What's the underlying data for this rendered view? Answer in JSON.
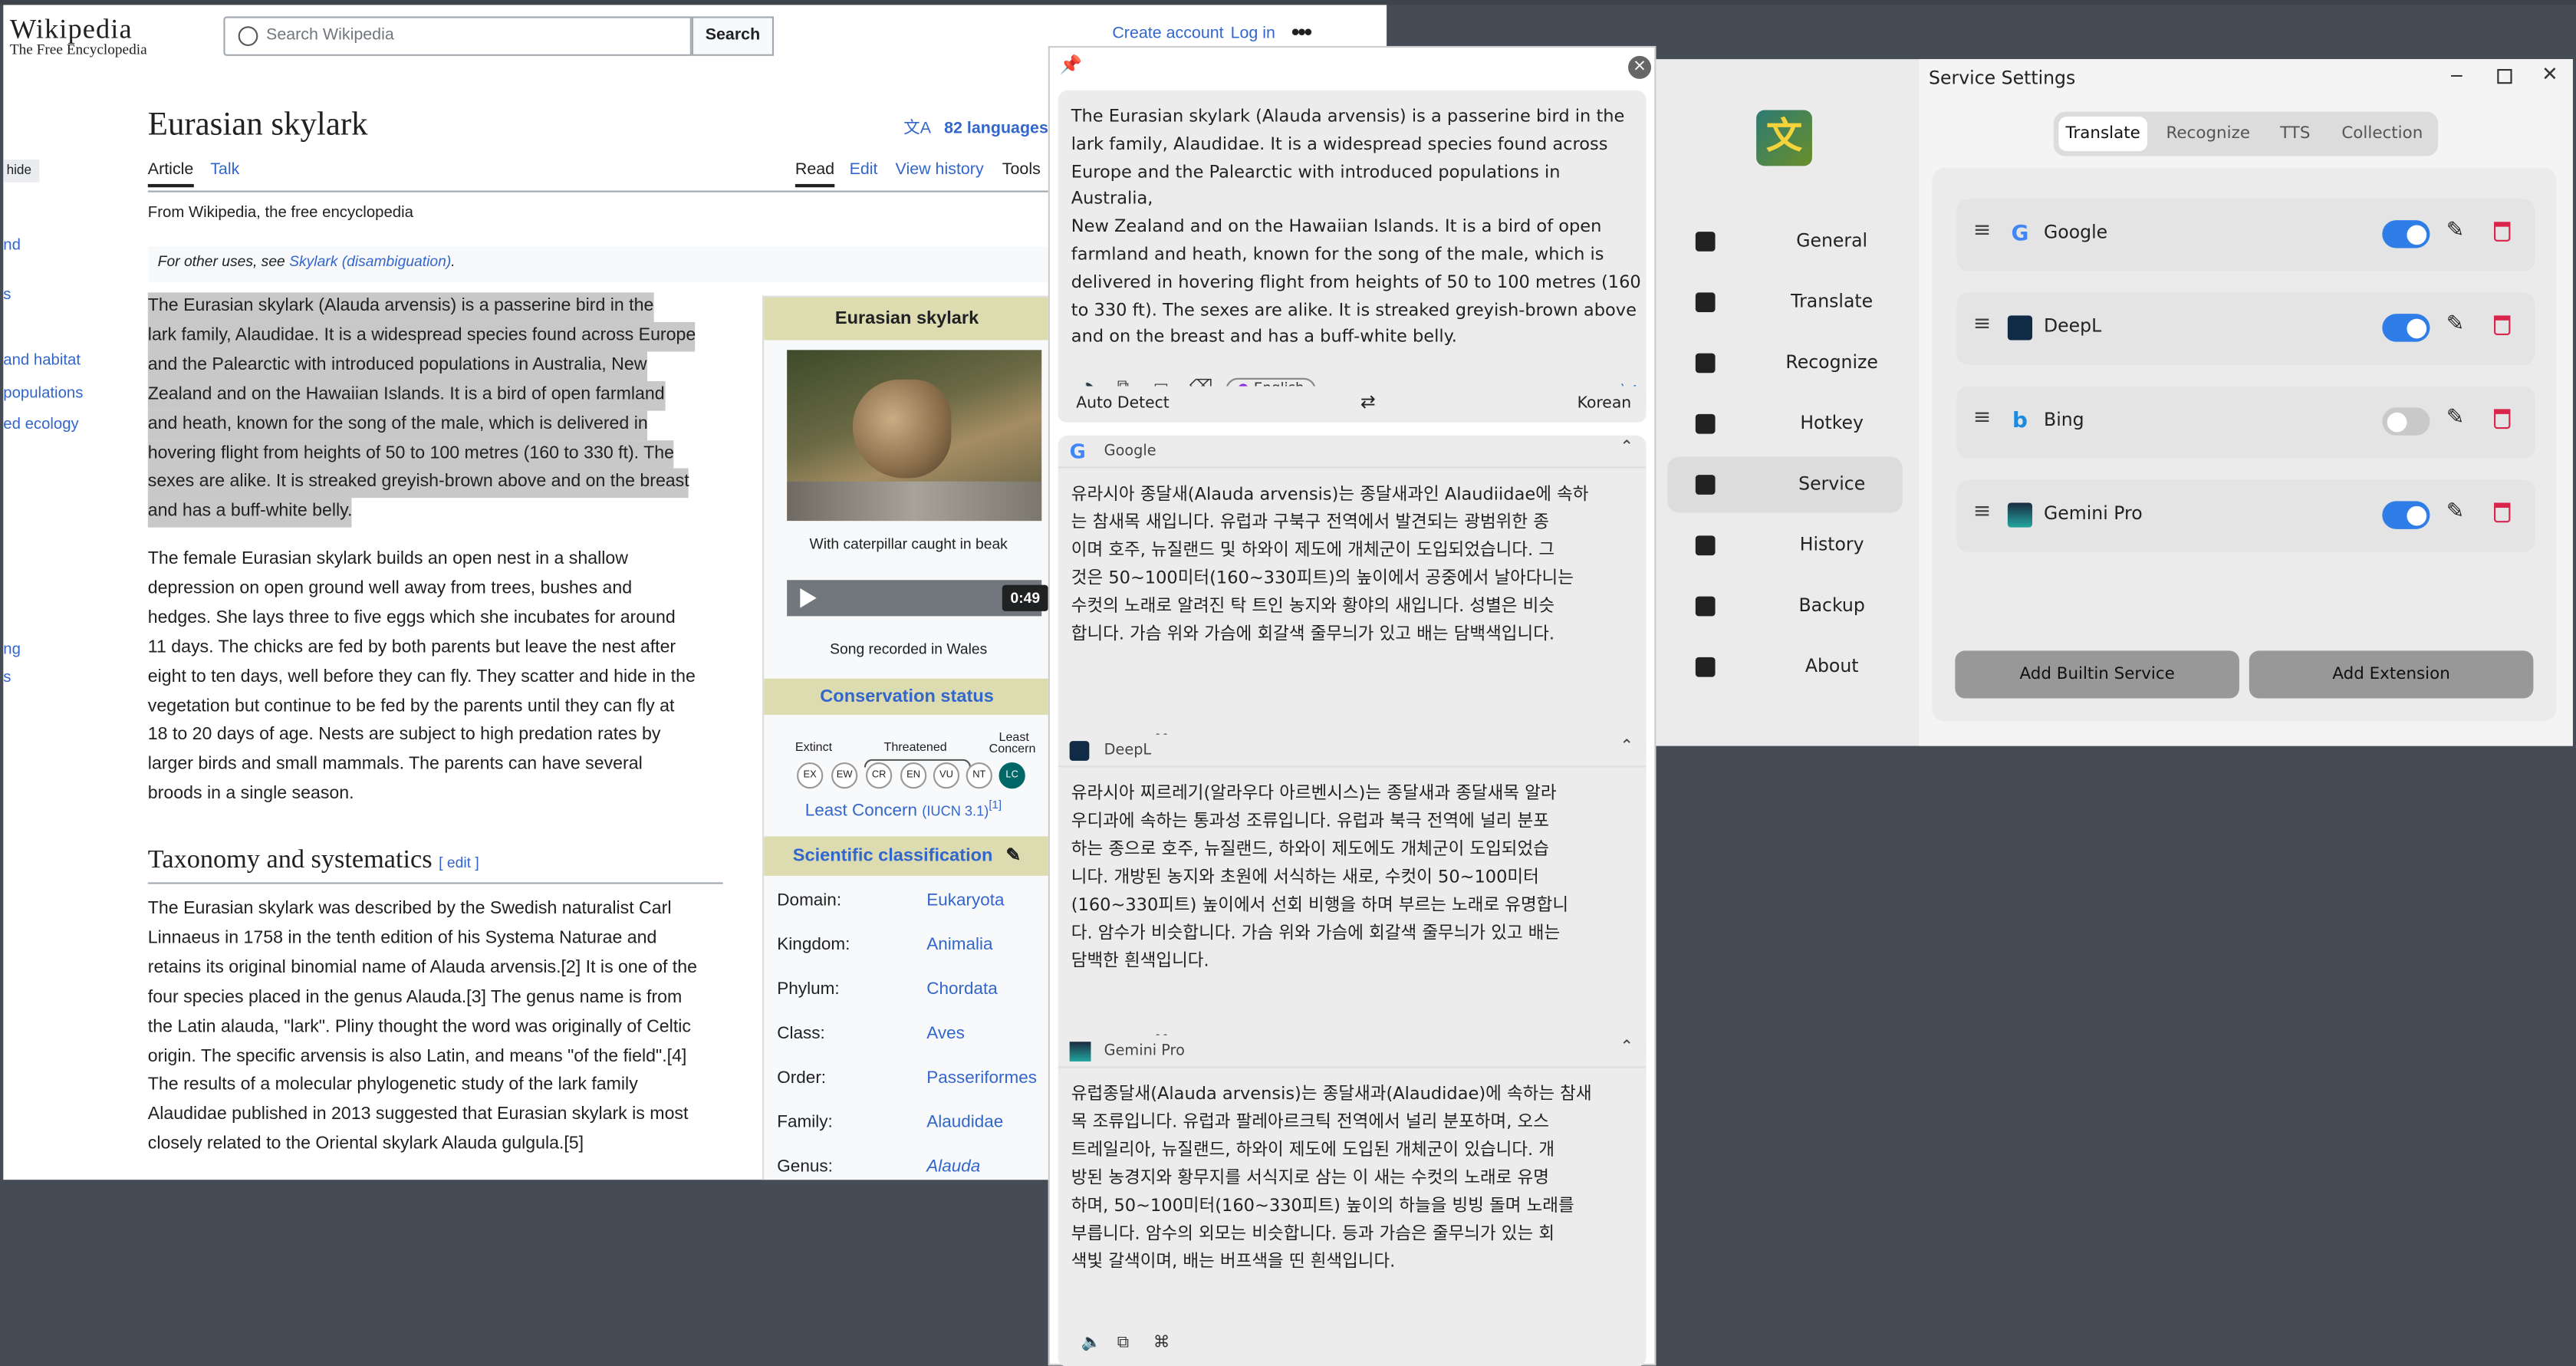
{
  "wiki": {
    "logo": "Wikipedia",
    "tagline": "The Free Encyclopedia",
    "search_placeholder": "Search Wikipedia",
    "search_button": "Search",
    "create_account": "Create account",
    "login": "Log in",
    "title": "Eurasian skylark",
    "languages": "82 languages",
    "tab_article": "Article",
    "tab_talk": "Talk",
    "tab_read": "Read",
    "tab_edit": "Edit",
    "tab_history": "View history",
    "tab_tools": "Tools",
    "from": "From Wikipedia, the free encyclopedia",
    "hatnote_prefix": "For other uses, see ",
    "hatnote_link": "Skylark (disambiguation)",
    "hatnote_suffix": ".",
    "hide": "hide",
    "leftnav": [
      "nd",
      "s",
      "and habitat",
      "populations",
      "ed ecology",
      "ng",
      "s"
    ],
    "para1": [
      "The Eurasian skylark (Alauda arvensis) is a passerine bird in the",
      "lark family, Alaudidae. It is a widespread species found across Europe",
      "and the Palearctic with introduced populations in Australia, New",
      "Zealand and on the Hawaiian Islands. It is a bird of open farmland",
      "and heath, known for the song of the male, which is delivered in",
      "hovering flight from heights of 50 to 100 metres (160 to 330 ft). The",
      "sexes are alike. It is streaked greyish-brown above and on the breast",
      "and has a buff-white belly."
    ],
    "para2": [
      "The female Eurasian skylark builds an open nest in a shallow",
      "depression on open ground well away from trees, bushes and",
      "hedges. She lays three to five eggs which she incubates for around",
      "11 days. The chicks are fed by both parents but leave the nest after",
      "eight to ten days, well before they can fly. They scatter and hide in the",
      "vegetation but continue to be fed by the parents until they can fly at",
      "18 to 20 days of age. Nests are subject to high predation rates by",
      "larger birds and small mammals. The parents can have several",
      "broods in a single season."
    ],
    "h2": "Taxonomy and systematics",
    "h2_edit": "[ edit ]",
    "para3": [
      "The Eurasian skylark was described by the Swedish naturalist Carl",
      "Linnaeus in 1758 in the tenth edition of his Systema Naturae and",
      "retains its original binomial name of Alauda arvensis.[2] It is one of the",
      "four species placed in the genus Alauda.[3] The genus name is from",
      "the Latin alauda, \"lark\". Pliny thought the word was originally of Celtic",
      "origin. The specific arvensis is also Latin, and means \"of the field\".[4]",
      "The results of a molecular phylogenetic study of the lark family",
      "Alaudidae published in 2013 suggested that Eurasian skylark is most",
      "closely related to the Oriental skylark Alauda gulgula.[5]"
    ],
    "infobox": {
      "title": "Eurasian skylark",
      "caption": "With caterpillar caught in beak",
      "duration": "0:49",
      "audio_caption": "Song recorded in Wales",
      "conservation": "Conservation status",
      "extinct": "Extinct",
      "threatened": "Threatened",
      "least_concern_top": "Least",
      "least_concern_bottom": "Concern",
      "codes": [
        "EX",
        "EW",
        "CR",
        "EN",
        "VU",
        "NT",
        "LC"
      ],
      "status_text": "Least Concern",
      "status_ref": "(IUCN 3.1)",
      "status_note": "[1]",
      "sci": "Scientific classification",
      "rows": [
        {
          "k": "Domain:",
          "v": "Eukaryota"
        },
        {
          "k": "Kingdom:",
          "v": "Animalia"
        },
        {
          "k": "Phylum:",
          "v": "Chordata"
        },
        {
          "k": "Class:",
          "v": "Aves"
        },
        {
          "k": "Order:",
          "v": "Passeriformes"
        },
        {
          "k": "Family:",
          "v": "Alaudidae"
        },
        {
          "k": "Genus:",
          "v": "Alauda"
        }
      ]
    }
  },
  "translator": {
    "source_text": [
      "The Eurasian skylark (Alauda arvensis) is a passerine bird in the",
      "lark family, Alaudidae. It is a widespread species found across",
      "Europe and the Palearctic with introduced populations in Australia,",
      "New Zealand and on the Hawaiian Islands. It is a bird of open",
      "farmland and heath, known for the song of the male, which is",
      "delivered in hovering flight from heights of 50 to 100 metres (160",
      "to 330 ft). The sexes are alike. It is streaked greyish-brown above",
      "and on the breast and has a buff-white belly."
    ],
    "detected_lang": "English",
    "from_lang": "Auto Detect",
    "to_lang": "Korean",
    "results": [
      {
        "service": "Google",
        "lines": [
          "유라시아 종달새(Alauda arvensis)는 종달새과인 Alaudiidae에 속하",
          "는 참새목 새입니다. 유럽과 구북구 전역에서 발견되는 광범위한 종",
          "이며 호주, 뉴질랜드 및 하와이 제도에 개체군이 도입되었습니다. 그",
          "것은 50~100미터(160~330피트)의 높이에서 공중에서 날아다니는",
          "수컷의 노래로 알려진 탁 트인 농지와 황야의 새입니다. 성별은 비슷",
          "합니다. 가슴 위와 가슴에 회갈색 줄무늬가 있고 배는 담백색입니다."
        ]
      },
      {
        "service": "DeepL",
        "lines": [
          "유라시아 찌르레기(알라우다 아르벤시스)는 종달새과 종달새목 알라",
          "우디과에 속하는 통과성 조류입니다. 유럽과 북극 전역에 널리 분포",
          "하는 종으로 호주, 뉴질랜드, 하와이 제도에도 개체군이 도입되었습",
          "니다. 개방된 농지와 초원에 서식하는 새로, 수컷이 50~100미터",
          "(160~330피트) 높이에서 선회 비행을 하며 부르는 노래로 유명합니",
          "다. 암수가 비슷합니다. 가슴 위와 가슴에 회갈색 줄무늬가 있고 배는",
          "담백한 흰색입니다."
        ]
      },
      {
        "service": "Gemini Pro",
        "lines": [
          "유럽종달새(Alauda arvensis)는 종달새과(Alaudidae)에 속하는 참새",
          "목 조류입니다. 유럽과 팔레아르크틱 전역에서 널리 분포하며, 오스",
          "트레일리아, 뉴질랜드, 하와이 제도에 도입된 개체군이 있습니다. 개",
          "방된 농경지와 황무지를 서식지로 삼는 이 새는 수컷의 노래로 유명",
          "하며, 50~100미터(160~330피트) 높이의 하늘을 빙빙 돌며 노래를",
          "부릅니다. 암수의 외모는 비슷합니다. 등과 가슴은 줄무늬가 있는 회",
          "색빛 갈색이며, 배는 버프색을 띤 흰색입니다."
        ]
      }
    ]
  },
  "settings": {
    "window_title": "Service Settings",
    "app_icon_glyph": "文",
    "nav": [
      "General",
      "Translate",
      "Recognize",
      "Hotkey",
      "Service",
      "History",
      "Backup",
      "About"
    ],
    "active_nav": "Service",
    "tabs": [
      "Translate",
      "Recognize",
      "TTS",
      "Collection"
    ],
    "active_tab": "Translate",
    "services": [
      {
        "name": "Google",
        "enabled": true
      },
      {
        "name": "DeepL",
        "enabled": true
      },
      {
        "name": "Bing",
        "enabled": false
      },
      {
        "name": "Gemini Pro",
        "enabled": true
      }
    ],
    "add_builtin": "Add Builtin Service",
    "add_extension": "Add Extension",
    "colors": {
      "accent": "#2f7ee8",
      "delete": "#d9254c"
    }
  }
}
